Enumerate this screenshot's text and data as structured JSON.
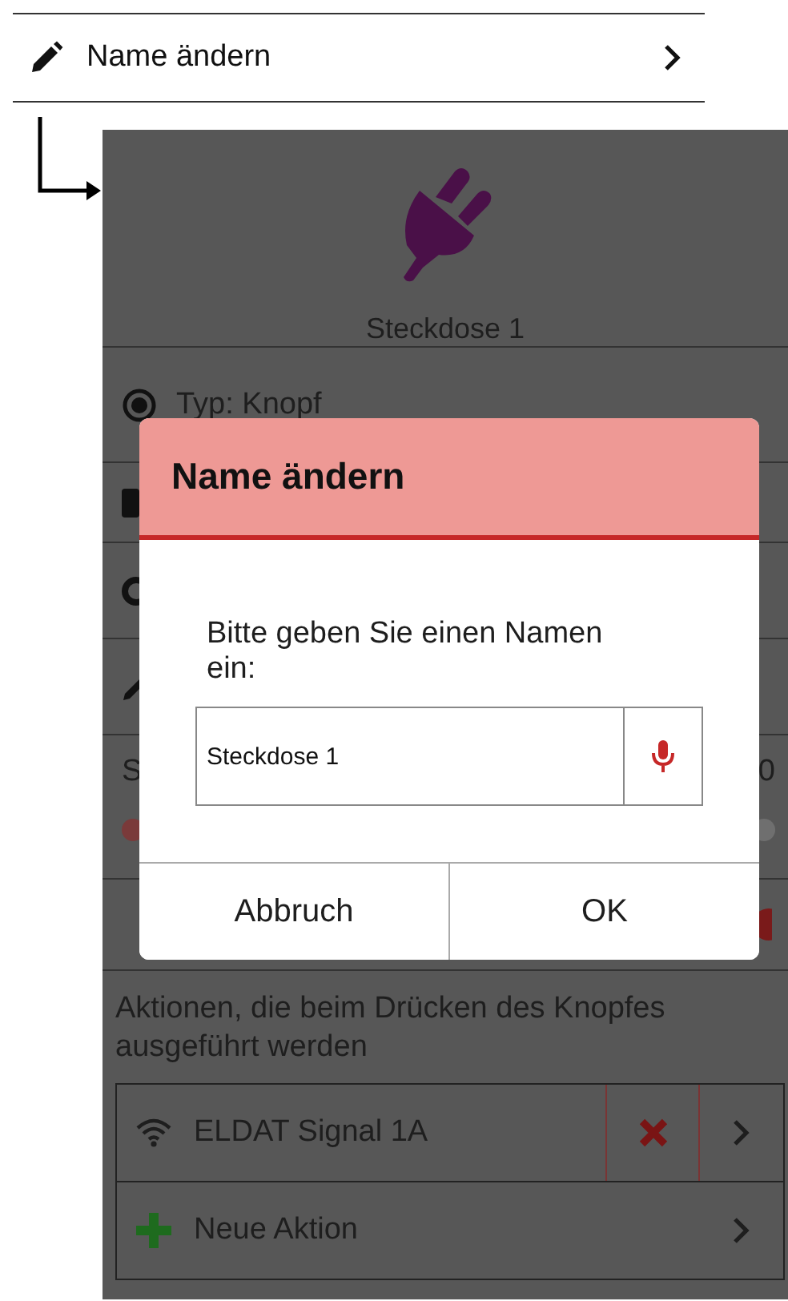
{
  "menu_item": {
    "label": "Name ändern"
  },
  "screen": {
    "device_name": "Steckdose 1",
    "type_option": {
      "label": "Typ: Knopf",
      "selected": true
    },
    "slider_label_fragment": "S",
    "slider_value_fragment": "0",
    "dialog": {
      "title": "Name ändern",
      "message": "Bitte geben Sie einen Namen ein:",
      "input_value": "Steckdose 1",
      "buttons": [
        "Abbruch",
        "OK"
      ]
    },
    "actions_caption": "Aktionen, die beim Drücken des Knopfes ausgeführt werden",
    "actions": [
      {
        "kind": "signal",
        "label": "ELDAT Signal 1A"
      },
      {
        "kind": "add",
        "label": "Neue Aktion"
      }
    ]
  }
}
